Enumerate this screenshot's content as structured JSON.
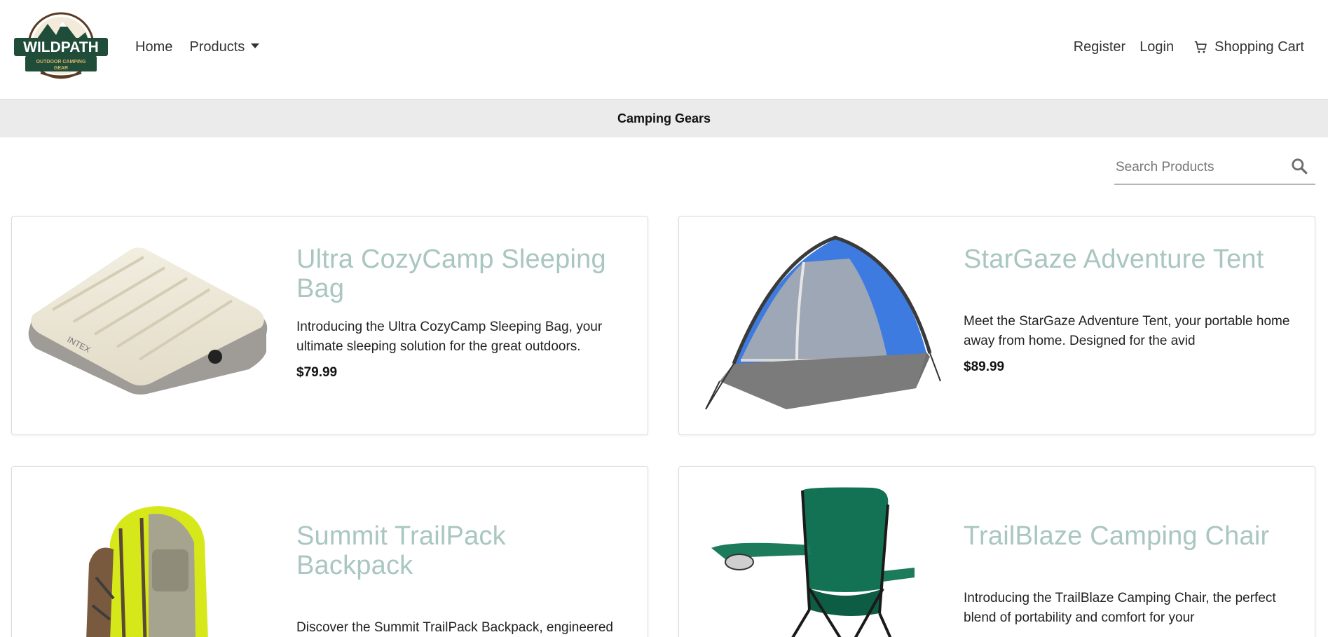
{
  "brand": {
    "logo_title": "WILDPATH",
    "logo_subtitle_1": "OUTDOOR CAMPING",
    "logo_subtitle_2": "GEAR"
  },
  "nav": {
    "home": "Home",
    "products": "Products",
    "register": "Register",
    "login": "Login",
    "cart": "Shopping Cart"
  },
  "category": {
    "title": "Camping Gears"
  },
  "search": {
    "placeholder": "Search Products"
  },
  "products": [
    {
      "title": "Ultra CozyCamp Sleeping Bag",
      "description": "Introducing the Ultra CozyCamp Sleeping Bag, your ultimate sleeping solution for the great outdoors.",
      "price": "$79.99",
      "image_icon": "air-mattress-image"
    },
    {
      "title": "StarGaze Adventure Tent",
      "description": "Meet the StarGaze Adventure Tent, your portable home away from home. Designed for the avid",
      "price": "$89.99",
      "image_icon": "tent-image"
    },
    {
      "title": "Summit TrailPack Backpack",
      "description": "Discover the Summit TrailPack Backpack, engineered for the ultimate hiking experience. It's not just a",
      "price": "",
      "image_icon": "backpack-image"
    },
    {
      "title": "TrailBlaze Camping Chair",
      "description": "Introducing the TrailBlaze Camping Chair, the perfect blend of portability and comfort for your",
      "price": "",
      "image_icon": "camping-chair-image"
    }
  ],
  "colors": {
    "product_title": "#a9c6c0",
    "category_bar": "#ebebeb",
    "logo_green": "#1f4d3a"
  }
}
